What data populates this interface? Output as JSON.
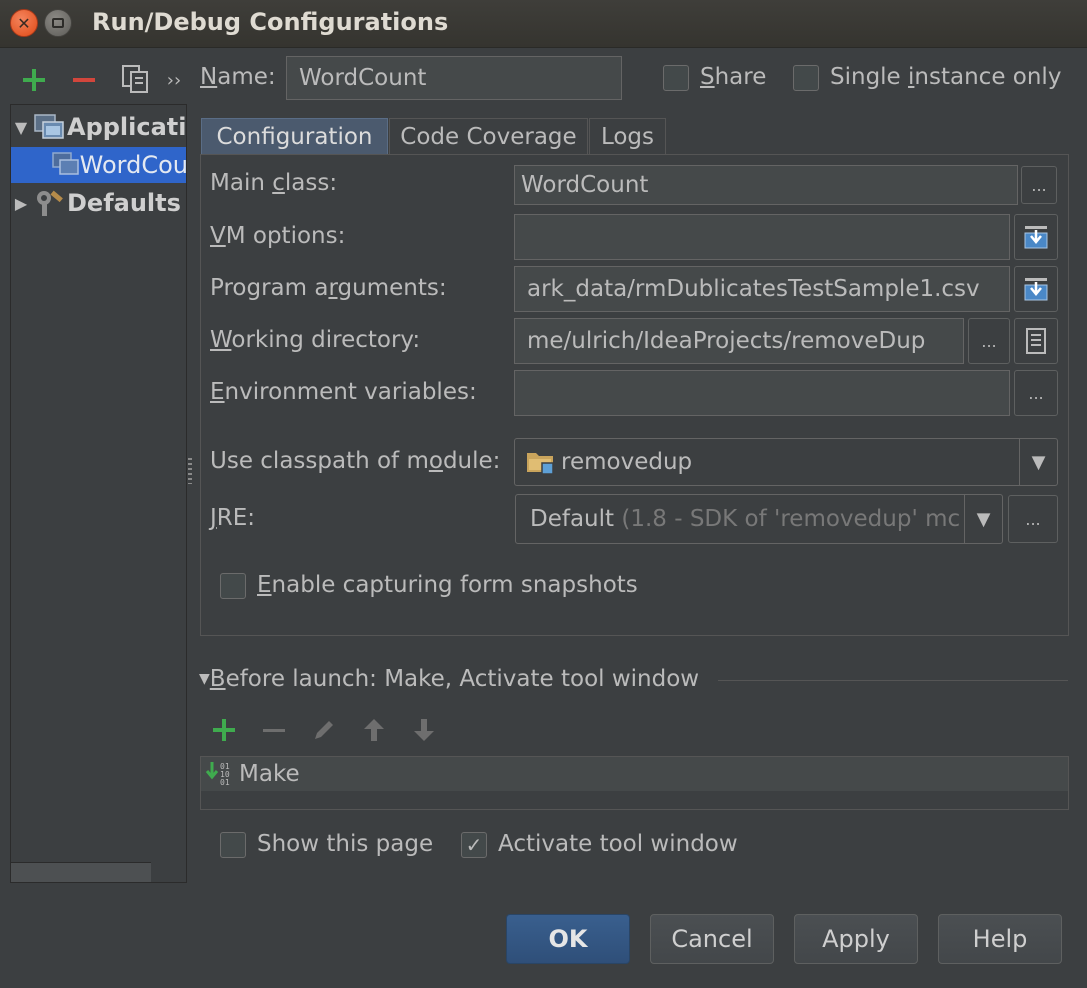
{
  "window": {
    "title": "Run/Debug Configurations"
  },
  "sidebar": {
    "tree": [
      {
        "label": "Applicati",
        "bold": true
      },
      {
        "label": "WordCou",
        "selected": true
      },
      {
        "label": "Defaults",
        "bold": true
      }
    ]
  },
  "name_row": {
    "label_first": "N",
    "label_rest": "ame:",
    "value": "WordCount",
    "share_first": "S",
    "share_rest": "hare",
    "single_a": "Single ",
    "single_u": "i",
    "single_b": "nstance only"
  },
  "tabs": [
    "Configuration",
    "Code Coverage",
    "Logs"
  ],
  "form": {
    "main_class_a": "Main ",
    "main_class_u": "c",
    "main_class_b": "lass:",
    "main_class_value": "WordCount",
    "vm_u": "V",
    "vm_rest": "M options:",
    "vm_value": "",
    "prog_a": "Program a",
    "prog_u": "r",
    "prog_b": "guments:",
    "prog_value": "ark_data/rmDublicatesTestSample1.csv",
    "wd_u": "W",
    "wd_rest": "orking directory:",
    "wd_value": "me/ulrich/IdeaProjects/removeDup",
    "env_u": "E",
    "env_rest": "nvironment variables:",
    "env_value": "",
    "cp_a": "Use classpath of m",
    "cp_u": "o",
    "cp_b": "dule:",
    "cp_value": "removedup",
    "jre_u": "J",
    "jre_rest": "RE:",
    "jre_value": "Default",
    "jre_hint": " (1.8 - SDK of 'removedup' mc",
    "snap_u": "E",
    "snap_rest": "nable capturing form snapshots",
    "ellipsis": "..."
  },
  "before_launch": {
    "title_u": "B",
    "title_rest": "efore launch: Make, Activate tool window",
    "items": [
      "Make"
    ]
  },
  "options": {
    "show_page": "Show this page",
    "activate": "Activate tool window",
    "check_mark": "✓"
  },
  "buttons": {
    "ok": "OK",
    "cancel": "Cancel",
    "apply": "Apply",
    "help": "Help"
  }
}
